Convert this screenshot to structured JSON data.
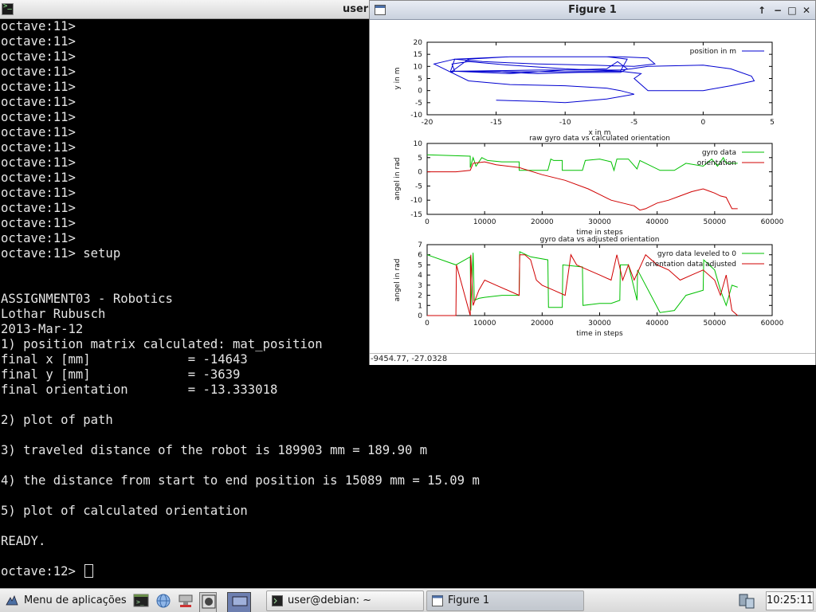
{
  "terminal": {
    "title": "user@debian: ~",
    "lines": [
      "octave:11>",
      "octave:11>",
      "octave:11>",
      "octave:11>",
      "octave:11>",
      "octave:11>",
      "octave:11>",
      "octave:11>",
      "octave:11>",
      "octave:11>",
      "octave:11>",
      "octave:11>",
      "octave:11>",
      "octave:11>",
      "octave:11>",
      "octave:11> setup",
      "",
      "",
      "ASSIGNMENT03 - Robotics",
      "Lothar Rubusch",
      "2013-Mar-12",
      "1) position matrix calculated: mat_position",
      "final x [mm]             = -14643",
      "final y [mm]             = -3639",
      "final orientation        = -13.333018",
      "",
      "2) plot of path",
      "",
      "3) traveled distance of the robot is 189903 mm = 189.90 m",
      "",
      "4) the distance from start to end position is 15089 mm = 15.09 m",
      "",
      "5) plot of calculated orientation",
      "",
      "READY.",
      ""
    ],
    "prompt": "octave:12> "
  },
  "figure": {
    "title": "Figure 1",
    "controls": {
      "pin": "↑",
      "minimize": "−",
      "maximize": "□",
      "close": "✕"
    },
    "status_coords": "-9454.77, -27.0328"
  },
  "chart_data": [
    {
      "type": "line",
      "title": "",
      "xlabel": "x in m",
      "ylabel": "y in m",
      "xlim": [
        -20,
        5
      ],
      "ylim": [
        -10,
        20
      ],
      "xticks": [
        -20,
        -15,
        -10,
        -5,
        0,
        5
      ],
      "yticks": [
        -10,
        -5,
        0,
        5,
        10,
        15,
        20
      ],
      "legend_position": "top-right",
      "series": [
        {
          "name": "position in m",
          "color": "#0000d0",
          "x": [
            -15,
            -12,
            -10,
            -7,
            -5,
            -6,
            -7,
            -10,
            -14,
            -17,
            -19.5,
            -18,
            -14,
            -10,
            -6,
            -4,
            -3.5,
            -5,
            -8,
            -12,
            -16,
            -18,
            -18.3,
            -15,
            -10,
            -6,
            -5.5,
            -7,
            -10,
            -14,
            -17,
            -18.3,
            -18,
            -12,
            -6,
            -5.2,
            -4,
            0,
            2,
            3.5,
            3.7,
            2,
            0,
            -4,
            -5,
            -4.5,
            -6,
            -10,
            -14,
            -17,
            -18.2,
            -18,
            -14,
            -10,
            -7,
            -6.2,
            -5.5,
            -6,
            -9,
            -12,
            -14,
            -15,
            -16
          ],
          "y": [
            -4,
            -4.5,
            -5,
            -3.5,
            -1.5,
            0,
            1,
            2,
            2.5,
            4,
            11,
            13,
            14,
            14,
            14,
            13.5,
            11,
            10,
            10.5,
            11,
            12,
            13,
            8,
            7.8,
            7.8,
            8,
            13,
            14,
            14,
            14,
            13,
            7.5,
            8,
            8.5,
            8.5,
            9,
            10,
            10.5,
            9,
            6,
            4,
            2,
            0,
            0,
            5,
            7,
            8,
            9,
            10.5,
            12,
            11,
            8,
            7,
            8.5,
            9,
            12,
            9,
            7.5,
            7.5,
            7,
            7.5,
            8,
            8
          ]
        }
      ]
    },
    {
      "type": "line",
      "title": "raw gyro data vs calculated orientation",
      "xlabel": "time in steps",
      "ylabel": "angel in rad",
      "xlim": [
        0,
        60000
      ],
      "ylim": [
        -15,
        10
      ],
      "xticks": [
        0,
        10000,
        20000,
        30000,
        40000,
        50000,
        60000
      ],
      "yticks": [
        -15,
        -10,
        -5,
        0,
        5,
        10
      ],
      "legend_position": "top-right",
      "series": [
        {
          "name": "gyro data",
          "color": "#00c000",
          "x": [
            0,
            7500,
            7500,
            8000,
            8500,
            9500,
            10500,
            13000,
            16000,
            16000,
            18000,
            21000,
            21500,
            22000,
            23500,
            23500,
            27000,
            27500,
            30000,
            32000,
            32500,
            33000,
            35000,
            36500,
            37000,
            40500,
            43000,
            45000,
            48000,
            49500,
            50500,
            51500,
            52000,
            54000
          ],
          "x_note": "",
          "y": [
            6,
            5.5,
            1.5,
            5,
            2,
            5,
            4,
            3.5,
            3.5,
            0.5,
            0.5,
            0.5,
            4.5,
            4,
            4,
            0.5,
            0.5,
            4,
            4.5,
            3.5,
            0.5,
            4.5,
            4.5,
            1,
            4,
            0.5,
            0.5,
            3,
            2,
            4.5,
            2,
            5,
            3,
            3
          ]
        },
        {
          "name": "orientation",
          "color": "#d00000",
          "x": [
            0,
            5000,
            7500,
            8000,
            10000,
            12000,
            16000,
            20000,
            24000,
            28000,
            30000,
            32000,
            34000,
            36000,
            37000,
            38000,
            40000,
            42000,
            44000,
            46000,
            48000,
            50000,
            51000,
            52000,
            53000,
            54000
          ],
          "y": [
            0,
            0,
            0.5,
            3,
            3.5,
            2.5,
            1.5,
            -1,
            -3,
            -6,
            -8,
            -10,
            -11,
            -12,
            -13.5,
            -13,
            -11,
            -10,
            -8.5,
            -7,
            -6,
            -7.5,
            -8.5,
            -9,
            -13,
            -13
          ]
        }
      ]
    },
    {
      "type": "line",
      "title": "gyro data vs adjusted orientation",
      "xlabel": "time in steps",
      "ylabel": "angel in rad",
      "xlim": [
        0,
        60000
      ],
      "ylim": [
        0,
        7
      ],
      "xticks": [
        0,
        10000,
        20000,
        30000,
        40000,
        50000,
        60000
      ],
      "yticks": [
        0,
        1,
        2,
        3,
        4,
        5,
        6,
        7
      ],
      "legend_position": "top-right",
      "series": [
        {
          "name": "gyro data leveled to 0",
          "color": "#00c000",
          "x": [
            0,
            5000,
            7500,
            7600,
            8000,
            8200,
            9000,
            10000,
            13000,
            16000,
            16100,
            18000,
            21000,
            21100,
            23500,
            23600,
            27000,
            27100,
            30000,
            32000,
            33500,
            33600,
            35000,
            36500,
            36600,
            40500,
            43000,
            45000,
            48000,
            48100,
            50000,
            51000,
            52000,
            53000,
            54000
          ],
          "y": [
            6,
            5,
            5.8,
            0.5,
            6.2,
            1.5,
            1.7,
            1.8,
            2.0,
            2.0,
            6.3,
            5.8,
            5.5,
            0.8,
            0.8,
            5.0,
            4.8,
            1.0,
            1.2,
            1.2,
            1.5,
            5.0,
            5.0,
            1.5,
            4.5,
            0.3,
            0.5,
            2.0,
            2.5,
            5.5,
            4.5,
            2.5,
            1.0,
            3.0,
            2.8
          ]
        },
        {
          "name": "orientation data adjusted",
          "color": "#d00000",
          "x": [
            0,
            5000,
            5100,
            7500,
            7600,
            8000,
            9000,
            10000,
            12000,
            16000,
            16100,
            17000,
            18000,
            19000,
            20000,
            22000,
            24000,
            25000,
            26000,
            28000,
            30000,
            32000,
            33000,
            34000,
            35000,
            36000,
            38000,
            40000,
            42000,
            44000,
            46000,
            48000,
            50000,
            51000,
            52000,
            53000,
            54000
          ],
          "y": [
            0,
            0,
            5,
            0,
            6,
            1,
            2.5,
            3.5,
            3,
            2,
            6,
            6,
            5.5,
            3.5,
            3,
            2.5,
            2,
            6,
            5,
            4.5,
            4,
            3.5,
            6,
            3.5,
            5,
            3.5,
            6,
            5,
            4.5,
            3.5,
            4,
            4.5,
            3.5,
            2,
            4,
            0.5,
            0
          ]
        }
      ]
    }
  ],
  "taskbar": {
    "menu_label": "Menu de aplicações",
    "tasks": [
      {
        "label": "user@debian: ~",
        "icon": "terminal-icon"
      },
      {
        "label": "Figure 1",
        "icon": "window-icon"
      }
    ],
    "clock": "10:25:11"
  }
}
